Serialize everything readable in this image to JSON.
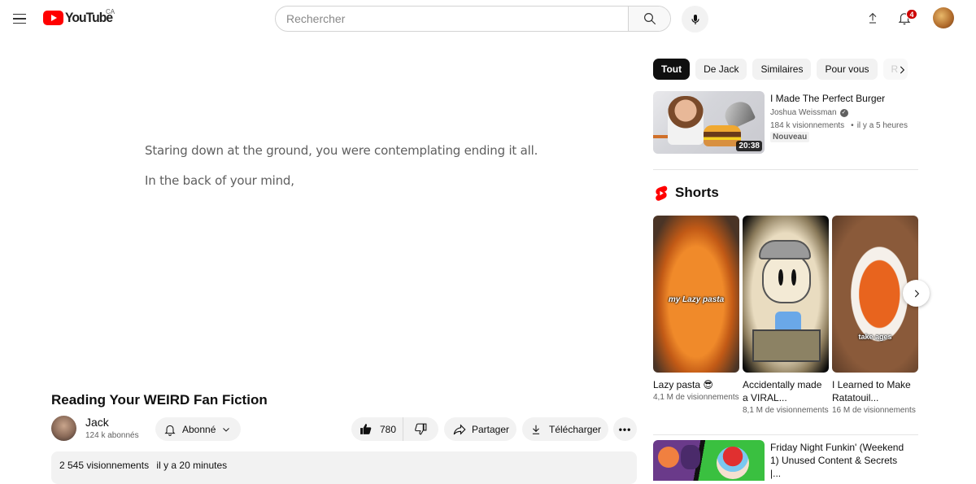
{
  "header": {
    "logo_text": "YouTube",
    "country_code": "CA",
    "search_placeholder": "Rechercher",
    "search_value": "",
    "notification_count": "4",
    "icons": {
      "menu": "hamburger-menu-icon",
      "search": "search-icon",
      "mic": "microphone-icon",
      "upload": "upload-icon",
      "notifications": "bell-icon"
    }
  },
  "player": {
    "caption_lines": [
      "Staring down at the ground, you were contemplating ending it all.",
      "In the back of your mind,"
    ]
  },
  "video": {
    "title": "Reading Your WEIRD Fan Fiction",
    "channel": "Jack",
    "subscribers": "124 k abonnés",
    "subscribe_label": "Abonné",
    "likes": "780",
    "share_label": "Partager",
    "download_label": "Télécharger",
    "more_label": "•••",
    "views": "2 545 visionnements",
    "posted": "il y a 20 minutes"
  },
  "sidebar": {
    "chips": [
      {
        "label": "Tout",
        "active": true
      },
      {
        "label": "De Jack",
        "active": false
      },
      {
        "label": "Similaires",
        "active": false
      },
      {
        "label": "Pour vous",
        "active": false
      },
      {
        "label": "R",
        "active": false
      }
    ],
    "recommendations": [
      {
        "title": "I Made The Perfect Burger",
        "channel": "Joshua Weissman",
        "verified": true,
        "views": "184 k visionnements",
        "age": "il y a 5 heures",
        "badge": "Nouveau",
        "duration": "20:38"
      },
      {
        "title": "Friday Night Funkin' (Weekend 1) Unused Content & Secrets |..."
      }
    ],
    "shorts": {
      "heading": "Shorts",
      "items": [
        {
          "title": "Lazy pasta 😎",
          "views": "4,1 M de visionnements",
          "overlay": "my Lazy pasta"
        },
        {
          "title": "Accidentally made a VIRAL...",
          "views": "8,1 M de visionnements",
          "overlay": ""
        },
        {
          "title": "I Learned to Make Ratatouil...",
          "views": "16 M de visionnements",
          "overlay": "take ages"
        }
      ]
    }
  },
  "colors": {
    "brand_red": "#ff0000",
    "badge_red": "#cc0000",
    "chip_bg": "#f2f2f2",
    "chip_active_bg": "#0f0f0f",
    "secondary_text": "#606060"
  }
}
